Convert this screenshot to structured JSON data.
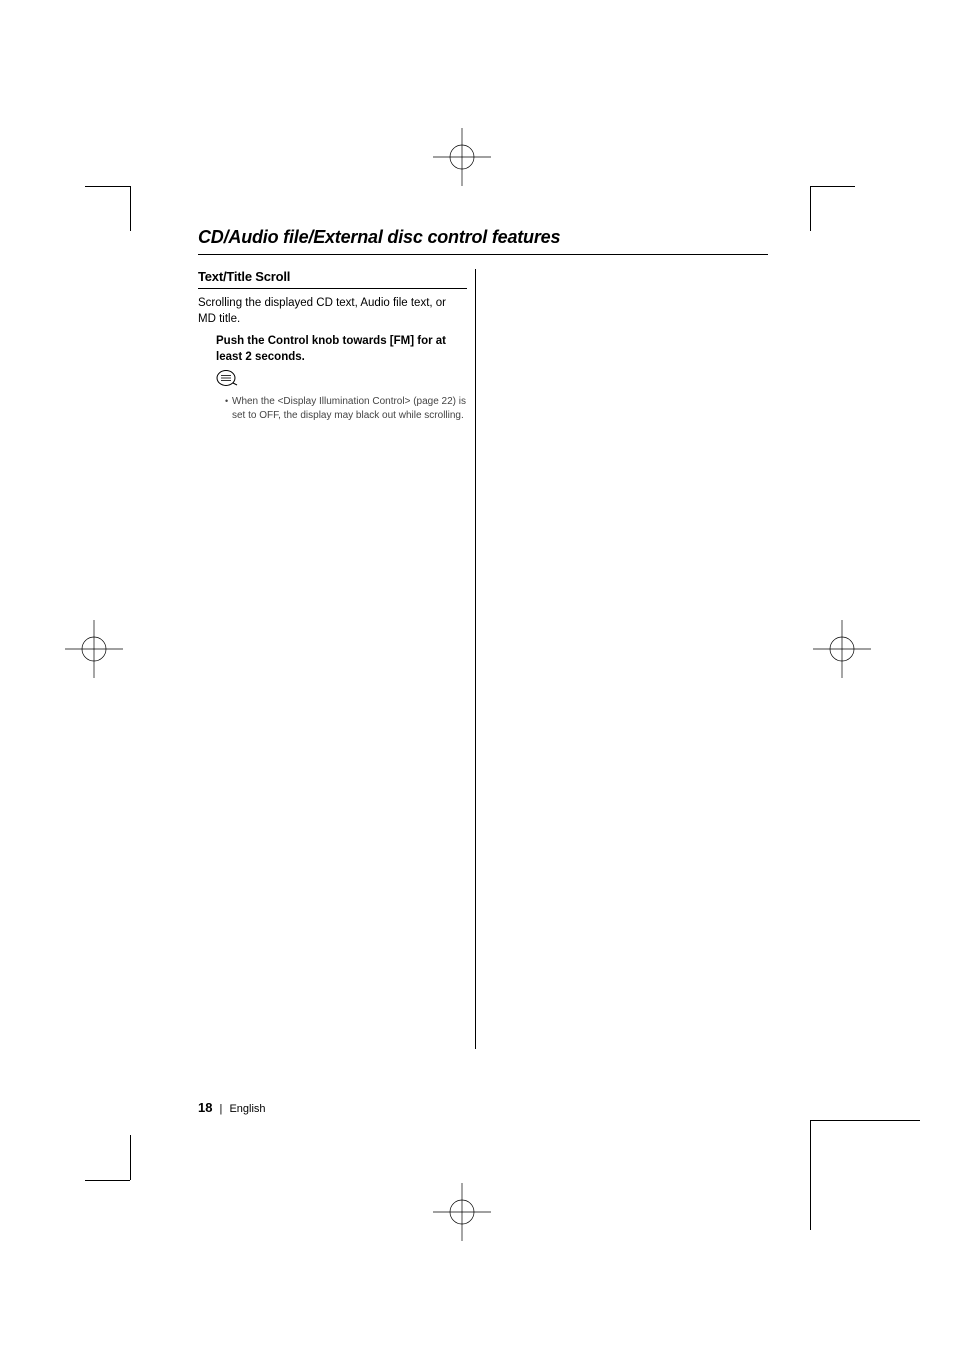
{
  "chapter_title": "CD/Audio file/External disc control features",
  "section": {
    "heading": "Text/Title Scroll",
    "intro": "Scrolling the displayed CD text, Audio file text, or MD title.",
    "instruction": "Push the Control knob towards [FM] for at least 2 seconds.",
    "note": "When the <Display Illumination Control> (page 22) is set to OFF, the display may black out while scrolling."
  },
  "footer": {
    "page_number": "18",
    "language": "English"
  }
}
